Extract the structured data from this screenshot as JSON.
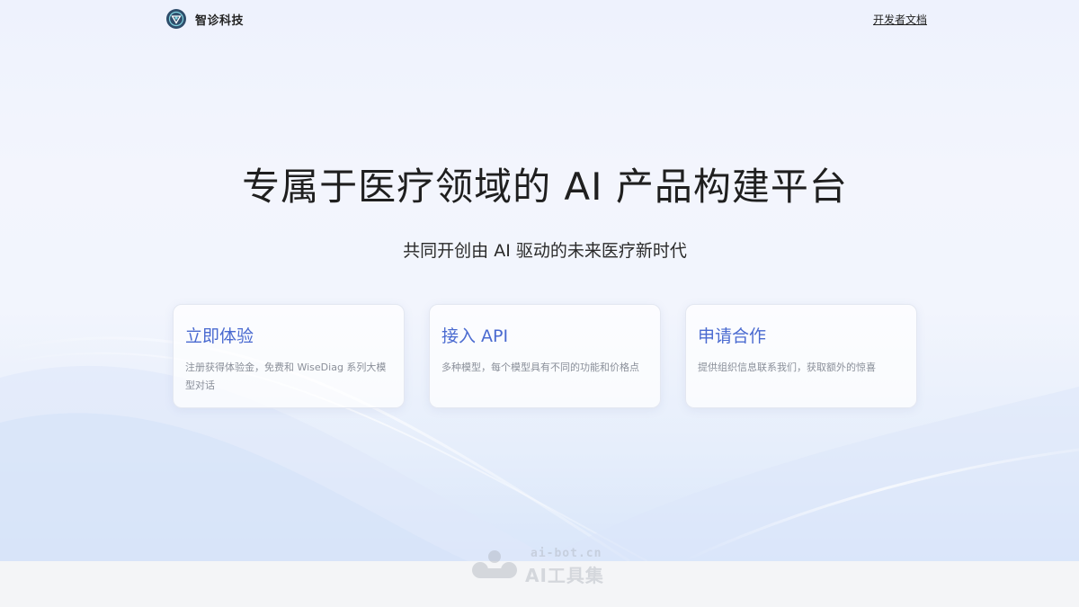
{
  "header": {
    "brand_name": "智诊科技",
    "logo_icon": "medical-shield-logo",
    "doc_link": "开发者文档"
  },
  "hero": {
    "title": "专属于医疗领域的 AI 产品构建平台",
    "subtitle": "共同开创由 AI 驱动的未来医疗新时代"
  },
  "cards": [
    {
      "title": "立即体验",
      "desc": "注册获得体验金，免费和 WiseDiag 系列大模型对话"
    },
    {
      "title": "接入 API",
      "desc": "多种模型，每个模型具有不同的功能和价格点"
    },
    {
      "title": "申请合作",
      "desc": "提供组织信息联系我们，获取额外的惊喜"
    }
  ],
  "watermark": {
    "domain": "ai-bot.cn",
    "name": "AI工具集"
  },
  "colors": {
    "accent": "#4a6ad0",
    "title": "#1f1f1f",
    "desc": "#8a8f99"
  }
}
